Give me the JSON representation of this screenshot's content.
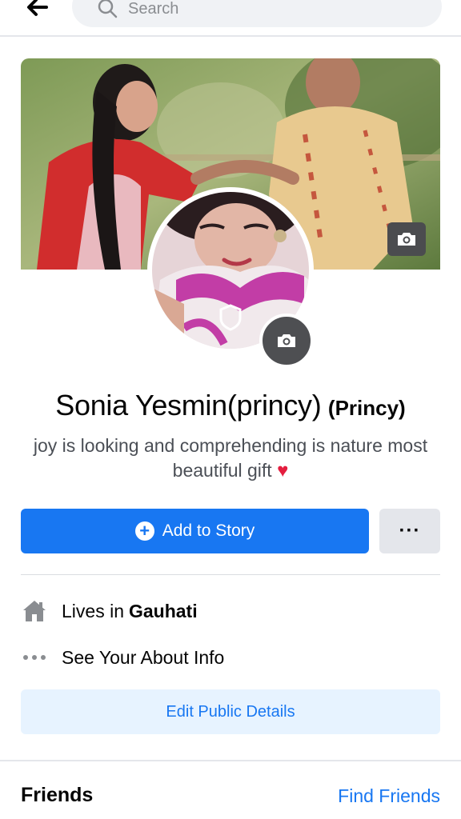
{
  "header": {
    "back_icon": "arrow-left-icon",
    "search_placeholder": "Search"
  },
  "profile": {
    "cover_photo": "cover-photo",
    "profile_photo": "profile-photo",
    "name": "Sonia Yesmin(princy)",
    "alternate_name": "(Princy)",
    "bio": "joy is looking and comprehending is nature most beautiful gift",
    "bio_emoji": "♥"
  },
  "actions": {
    "add_story_label": "Add to Story",
    "more_label": "···"
  },
  "details": {
    "lives_prefix": "Lives in",
    "lives_city": "Gauhati",
    "about_label": "See Your About Info",
    "edit_public_details_label": "Edit Public Details"
  },
  "friends": {
    "title": "Friends",
    "find_friends_label": "Find Friends"
  },
  "colors": {
    "accent": "#1877f2",
    "light_accent": "#e7f3ff",
    "secondary_button": "#e4e6eb",
    "heart": "#e41e3f"
  }
}
